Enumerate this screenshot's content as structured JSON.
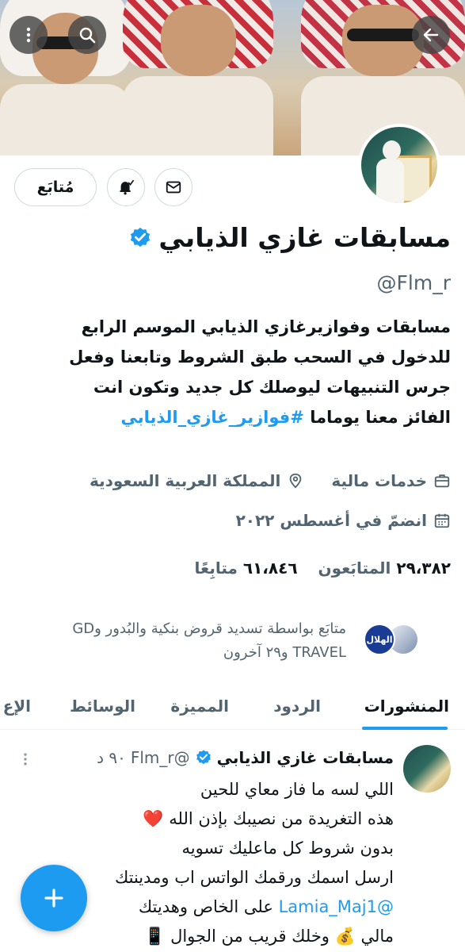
{
  "profile": {
    "name": "مسابقات غازي الذيابي",
    "handle": "@Flm_r",
    "bio_lines": [
      "مسابقات وفوازيرغازي الذيابي الموسم الرابع",
      "للدخول في السحب طبق الشروط وتابعنا وفعل",
      "جرس التنبيهات ليوصلك كل جديد وتكون انت"
    ],
    "bio_last_prefix": "الفائز معنا يوماما ",
    "bio_hashtag": "#فوازير_غازي_الذيابي",
    "category": "خدمات مالية",
    "location": "المملكة العربية السعودية",
    "joined": "انضمّ في أغسطس ٢٠٢٢",
    "following_count": "٢٩،٣٨٢",
    "following_label": "المتابَعون",
    "followers_count": "٦١،٨٤٦",
    "followers_label": "متابِعًا",
    "followed_by_line1": "متابَع بواسطة تسديد قروض بنكية والبُدور وGD",
    "followed_by_line2": "TRAVEL و٢٩ آخرون"
  },
  "actions": {
    "follow_label": "مُتابَع"
  },
  "tabs": [
    {
      "label": "المنشورات",
      "active": true
    },
    {
      "label": "الردود",
      "active": false
    },
    {
      "label": "المميزة",
      "active": false
    },
    {
      "label": "الوسائط",
      "active": false
    },
    {
      "label": "الإع",
      "active": false
    }
  ],
  "post": {
    "name": "مسابقات غازي الذيابي",
    "handle": "@Flm_r",
    "time": "٩٠ د",
    "lines": [
      "اللي لسه ما فاز معاي للحين",
      "هذه التغريدة من نصيبك بإذن الله ❤️",
      "بدون شروط كل ماعليك تسويه",
      "ارسل اسمك ورقمك الواتس اب ومدينتك"
    ],
    "line5_mention": "@Lamia_Maj1",
    "line5_rest": " على الخاص وهديتك",
    "line6": "مالي 💰 وخلك قريب من الجوال 📱"
  },
  "mini_avatar_text": "الهلال",
  "colors": {
    "accent": "#1d9bf0",
    "text": "#0f1419",
    "secondary": "#536471",
    "border": "#cfd9de"
  },
  "icons": [
    "back-arrow-icon",
    "search-icon",
    "more-vertical-icon",
    "bell-icon",
    "mail-icon",
    "verified-badge-icon",
    "briefcase-icon",
    "location-pin-icon",
    "calendar-icon",
    "compose-plus-icon"
  ]
}
